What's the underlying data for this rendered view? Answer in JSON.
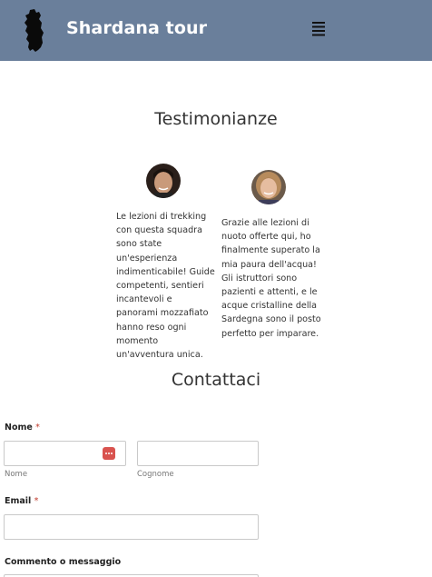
{
  "header": {
    "site_title": "Shardana tour",
    "background_color": "#6a7f9b",
    "logo_icon": "sardinia-map-icon",
    "menu_icon": "hamburger-menu-icon"
  },
  "testimonials": {
    "title": "Testimonianze",
    "items": [
      {
        "text": "Le lezioni di trekking con questa squadra sono state un'esperienza indimenticabile! Guide competenti, sentieri incantevoli e panorami mozzafiato hanno reso ogni momento un'avventura unica."
      },
      {
        "text": "Grazie alle lezioni di nuoto offerte qui, ho finalmente superato la mia paura dell'acqua! Gli istruttori sono pazienti e attenti, e le acque cristalline della Sardegna sono il posto perfetto per imparare."
      }
    ]
  },
  "contact": {
    "title": "Contattaci",
    "name_label": "Nome",
    "required_mark": "*",
    "first_name_value": "",
    "first_name_sublabel": "Nome",
    "last_name_value": "",
    "last_name_sublabel": "Cognome",
    "email_label": "Email",
    "email_value": "",
    "comment_label": "Commento o messaggio",
    "comment_value": "",
    "password_manager_icon": "password-manager-icon"
  }
}
